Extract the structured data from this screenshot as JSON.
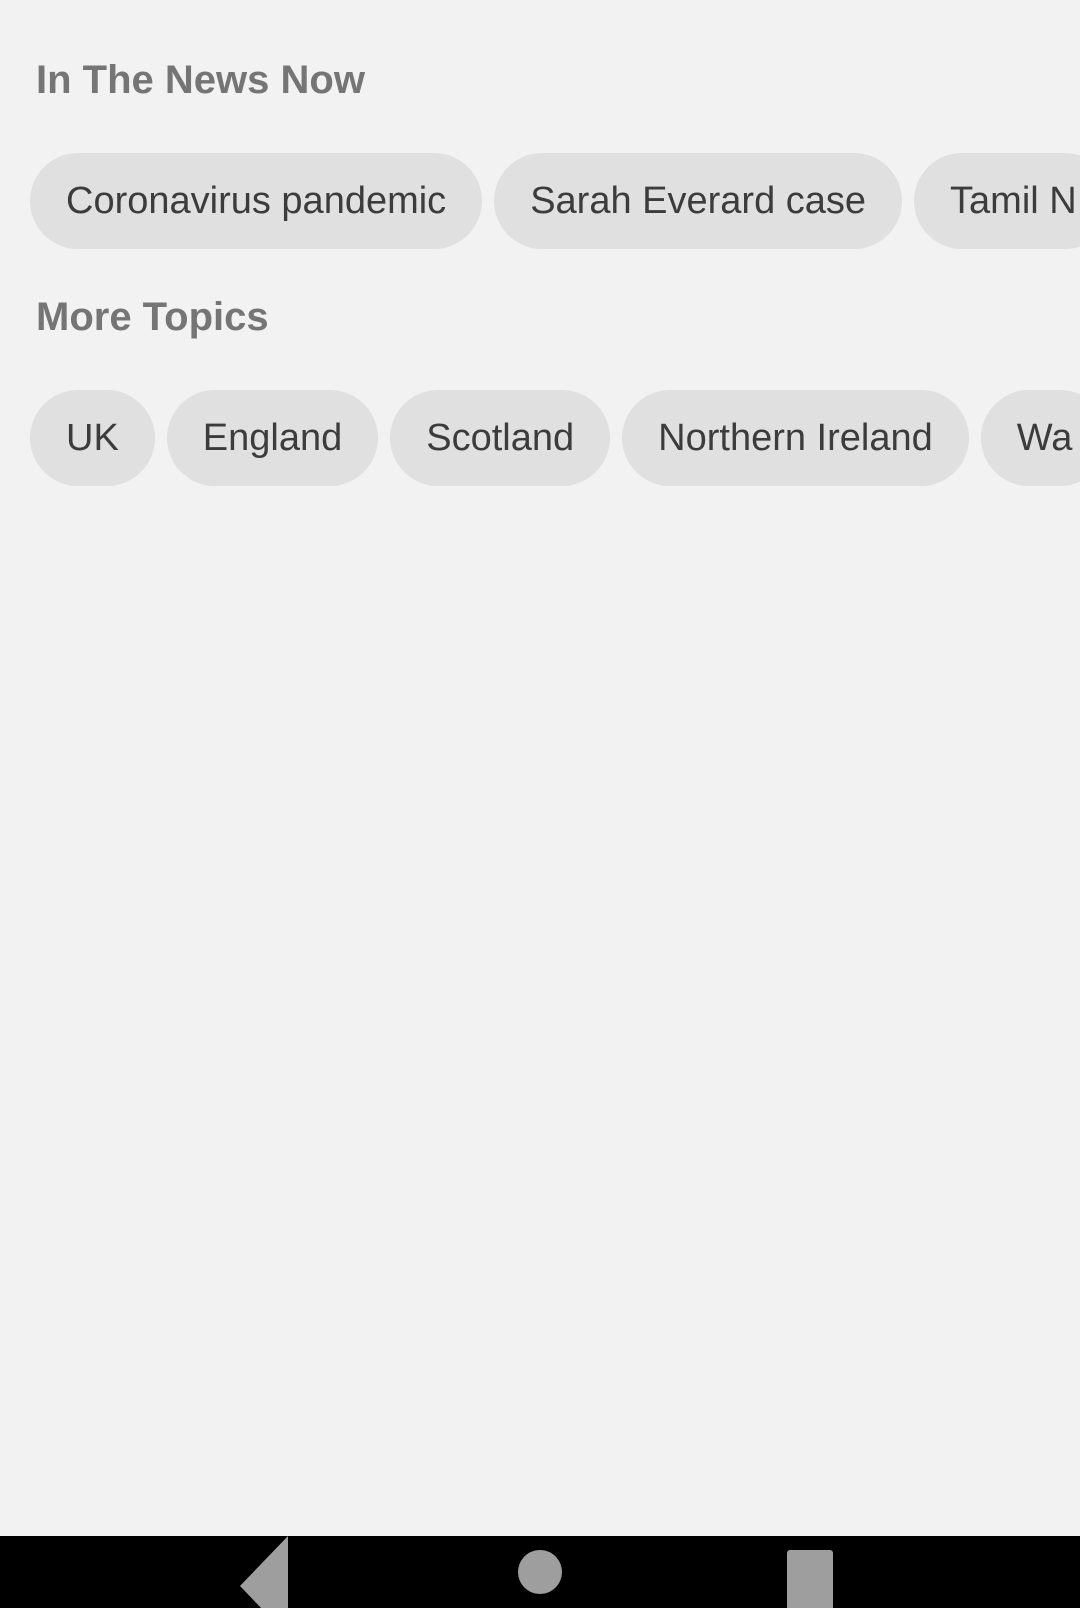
{
  "sections": {
    "in_the_news": {
      "title": "In The News Now",
      "chips": [
        "Coronavirus pandemic",
        "Sarah Everard case",
        "Tamil N"
      ]
    },
    "more_topics": {
      "title": "More Topics",
      "chips": [
        "UK",
        "England",
        "Scotland",
        "Northern Ireland",
        "Wa"
      ]
    }
  },
  "navbar": {
    "icons": [
      "back-icon",
      "home-icon",
      "recents-icon"
    ],
    "icon_color": "#9e9e9e"
  },
  "colors": {
    "background": "#f2f2f2",
    "chip_bg": "#e0e0e0",
    "chip_text": "#3c3c3c",
    "section_title": "#757575"
  }
}
